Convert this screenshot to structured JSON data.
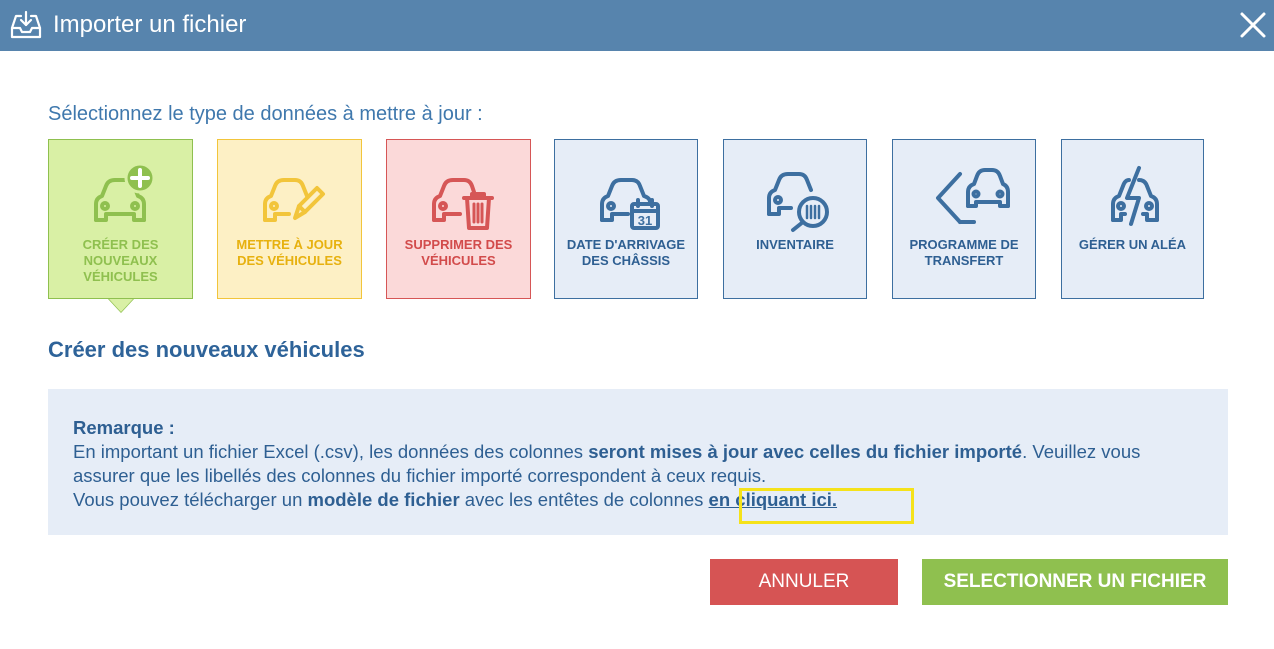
{
  "dialog": {
    "title": "Importer un fichier",
    "icons": {
      "title_icon": "import-tray-icon",
      "close_icon": "close-icon"
    }
  },
  "subtitle": "Sélectionnez le type de données à mettre à jour :",
  "tiles": [
    {
      "label": "CRÉER DES NOUVEAUX VÉHICULES",
      "icon": "car-add-icon",
      "selected": true,
      "color": "#8fc04f"
    },
    {
      "label": "METTRE À JOUR DES VÉHICULES",
      "icon": "car-edit-icon",
      "selected": false,
      "color": "#f2c53b"
    },
    {
      "label": "SUPPRIMER DES VÉHICULES",
      "icon": "car-delete-icon",
      "selected": false,
      "color": "#d65656"
    },
    {
      "label": "DATE D'ARRIVAGE DES CHÂSSIS",
      "icon": "car-calendar-icon",
      "selected": false,
      "color": "#3d6fa0"
    },
    {
      "label": "INVENTAIRE",
      "icon": "car-barcode-icon",
      "selected": false,
      "color": "#3d6fa0"
    },
    {
      "label": "PROGRAMME DE TRANSFERT",
      "icon": "car-transfer-icon",
      "selected": false,
      "color": "#3d6fa0"
    },
    {
      "label": "GÉRER UN ALÉA",
      "icon": "car-bolt-icon",
      "selected": false,
      "color": "#3d6fa0"
    }
  ],
  "section_title": "Créer des nouveaux véhicules",
  "note": {
    "title": "Remarque :",
    "p1_a": "En important un fichier Excel (.csv), les données des colonnes ",
    "p1_b": "seront mises à jour avec celles du fichier importé",
    "p1_c": ". Veuillez vous assurer que les libellés des colonnes du fichier importé correspondent à ceux requis.",
    "p2_a": "Vous pouvez télécharger un ",
    "p2_b": "modèle de fichier",
    "p2_c": " avec les entêtes de colonnes ",
    "p2_link": "en cliquant ici."
  },
  "buttons": {
    "cancel": "ANNULER",
    "select": "SELECTIONNER UN FICHIER"
  },
  "colors": {
    "header": "#5784ad",
    "accent_blue": "#2e6399",
    "cancel": "#d65454",
    "confirm": "#8fc04f",
    "highlight": "#f5e21a"
  }
}
